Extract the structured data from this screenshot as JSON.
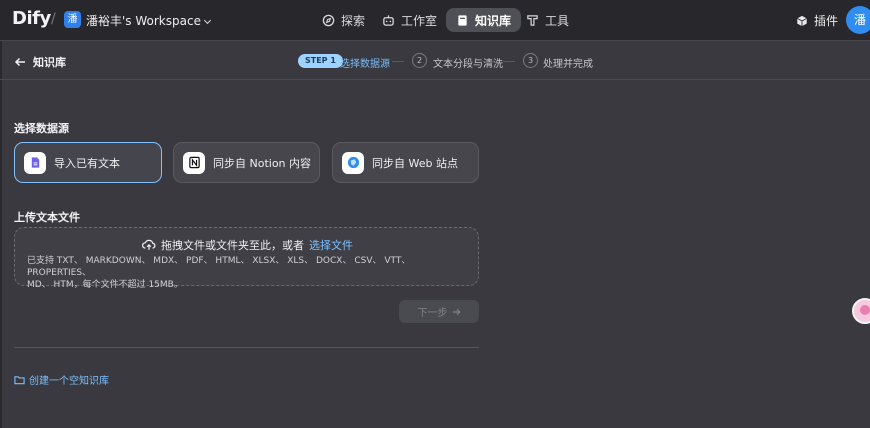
{
  "header": {
    "logo": "Dify",
    "separator": "/",
    "workspace_avatar": "潘",
    "workspace_name": "潘裕丰's Workspace",
    "nav": [
      {
        "label": "探索",
        "icon": "compass-icon"
      },
      {
        "label": "工作室",
        "icon": "robot-icon"
      },
      {
        "label": "知识库",
        "icon": "book-icon",
        "active": true
      },
      {
        "label": "工具",
        "icon": "tool-icon"
      }
    ],
    "plugins_label": "插件",
    "user_avatar": "潘"
  },
  "stepbar": {
    "back_label": "知识库",
    "steps": [
      {
        "badge": "STEP 1",
        "label": "选择数据源",
        "active": true
      },
      {
        "number": "2",
        "label": "文本分段与清洗"
      },
      {
        "number": "3",
        "label": "处理并完成"
      }
    ]
  },
  "main": {
    "source_title": "选择数据源",
    "sources": [
      {
        "label": "导入已有文本",
        "icon": "document-icon",
        "selected": true
      },
      {
        "label": "同步自 Notion 内容",
        "icon": "notion-icon"
      },
      {
        "label": "同步自 Web 站点",
        "icon": "web-icon"
      }
    ],
    "upload_title": "上传文本文件",
    "dropzone": {
      "prompt": "拖拽文件或文件夹至此，或者",
      "link": "选择文件",
      "supported_line1": "已支持 TXT、 MARKDOWN、 MDX、 PDF、 HTML、 XLSX、 XLS、 DOCX、 CSV、 VTT、 PROPERTIES、",
      "supported_line2": "MD、 HTM，每个文件不超过 15MB。"
    },
    "next_label": "下一步",
    "create_empty_label": "创建一个空知识库"
  },
  "colors": {
    "accent": "#7cc0ff",
    "brand_blue": "#2f80ed",
    "background": "#39393f",
    "topbar": "#28282c"
  }
}
